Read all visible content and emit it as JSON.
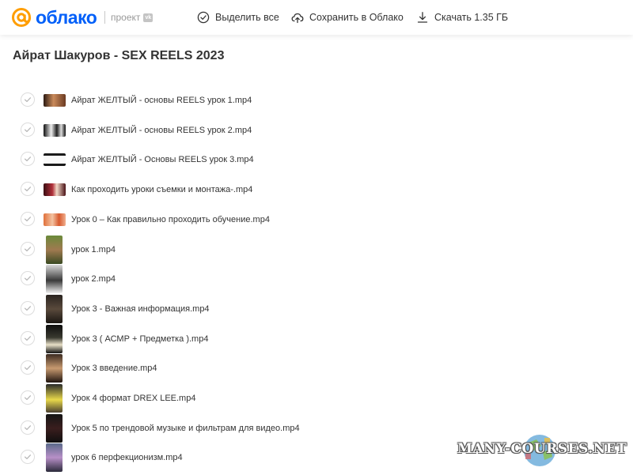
{
  "header": {
    "logo_text": "облако",
    "project_label": "проект",
    "vk_badge": "vk",
    "select_all": "Выделить все",
    "save_to_cloud": "Сохранить в Облако",
    "download": "Скачать 1.35 ГБ"
  },
  "folder_title": "Айрат Шакуров - SEX REELS 2023",
  "files": [
    {
      "name": "Айрат ЖЕЛТЫЙ - основы REELS урок 1.mp4",
      "thumb": "wide"
    },
    {
      "name": "Айрат ЖЕЛТЫЙ - основы REELS урок 2.mp4",
      "thumb": "wide"
    },
    {
      "name": "Айрат ЖЕЛТЫЙ - Основы REELS урок 3.mp4",
      "thumb": "wide"
    },
    {
      "name": "Как проходить уроки съемки и монтажа-.mp4",
      "thumb": "wide"
    },
    {
      "name": "Урок 0 – Как правильно проходить обучение.mp4",
      "thumb": "wide"
    },
    {
      "name": "урок 1.mp4",
      "thumb": "tall"
    },
    {
      "name": "урок 2.mp4",
      "thumb": "tall"
    },
    {
      "name": "Урок 3 - Важная информация.mp4",
      "thumb": "tall"
    },
    {
      "name": "Урок 3 ( АСМР + Предметка ).mp4",
      "thumb": "tall"
    },
    {
      "name": "Урок 3 введение.mp4",
      "thumb": "tall"
    },
    {
      "name": "Урок 4 формат DREX LEE.mp4",
      "thumb": "tall"
    },
    {
      "name": "Урок 5 по трендовой музыке и фильтрам для видео.mp4",
      "thumb": "tall"
    },
    {
      "name": "урок 6 перфекционизм.mp4",
      "thumb": "tall"
    }
  ],
  "watermark": "MANY-COURSES.NET",
  "colors": {
    "brand_orange": "#ff9e00",
    "brand_blue": "#005ff9",
    "text": "#333333",
    "muted": "#999999"
  }
}
